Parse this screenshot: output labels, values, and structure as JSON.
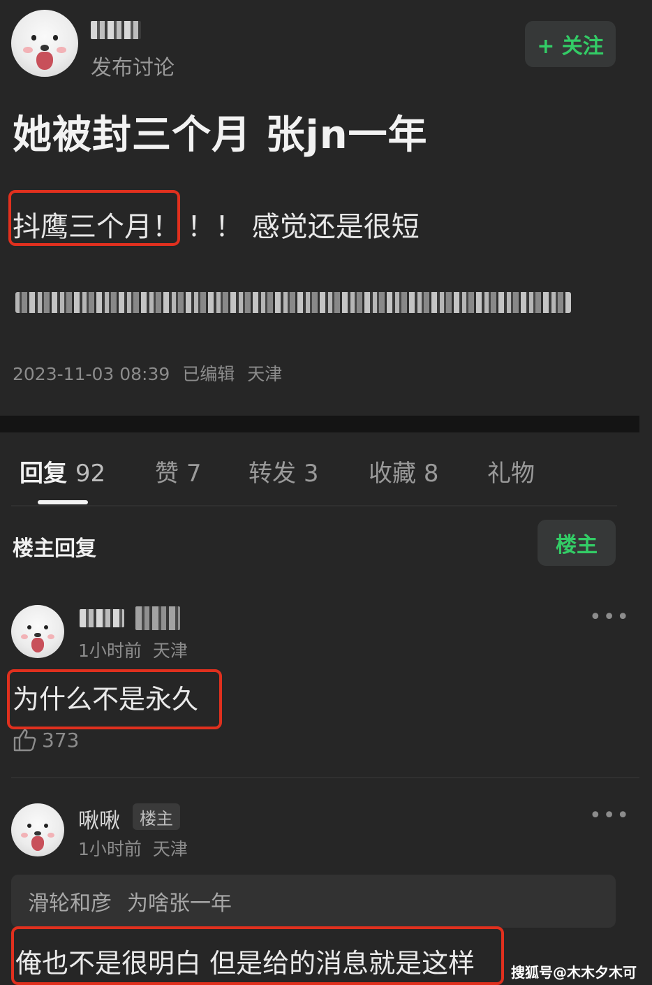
{
  "post": {
    "author_action": "发布讨论",
    "follow_label": "+ 关注",
    "title": "她被封三个月 张jn一年",
    "content_highlight": "抖鹰三个月！",
    "content_rest": "！！ 感觉还是很短",
    "timestamp": "2023-11-03 08:39",
    "edited": "已编辑",
    "location": "天津"
  },
  "tabs": [
    {
      "label": "回复",
      "count": "92"
    },
    {
      "label": "赞",
      "count": "7"
    },
    {
      "label": "转发",
      "count": "3"
    },
    {
      "label": "收藏",
      "count": "8"
    },
    {
      "label": "礼物",
      "count": ""
    }
  ],
  "replies_section": {
    "title": "楼主回复",
    "filter_label": "楼主"
  },
  "replies": [
    {
      "time": "1小时前",
      "location": "天津",
      "text": "为什么不是永久",
      "likes": "373"
    },
    {
      "name": "啾啾",
      "badge": "楼主",
      "time": "1小时前",
      "location": "天津",
      "quote_user": "滑轮和彦",
      "quote_text": "为啥张一年",
      "text": "俺也不是很明白 但是给的消息就是这样"
    }
  ],
  "watermark": "搜狐号@木木夕木可",
  "colors": {
    "background": "#262626",
    "accent_green": "#33cc66",
    "highlight_red": "#e0301e"
  }
}
